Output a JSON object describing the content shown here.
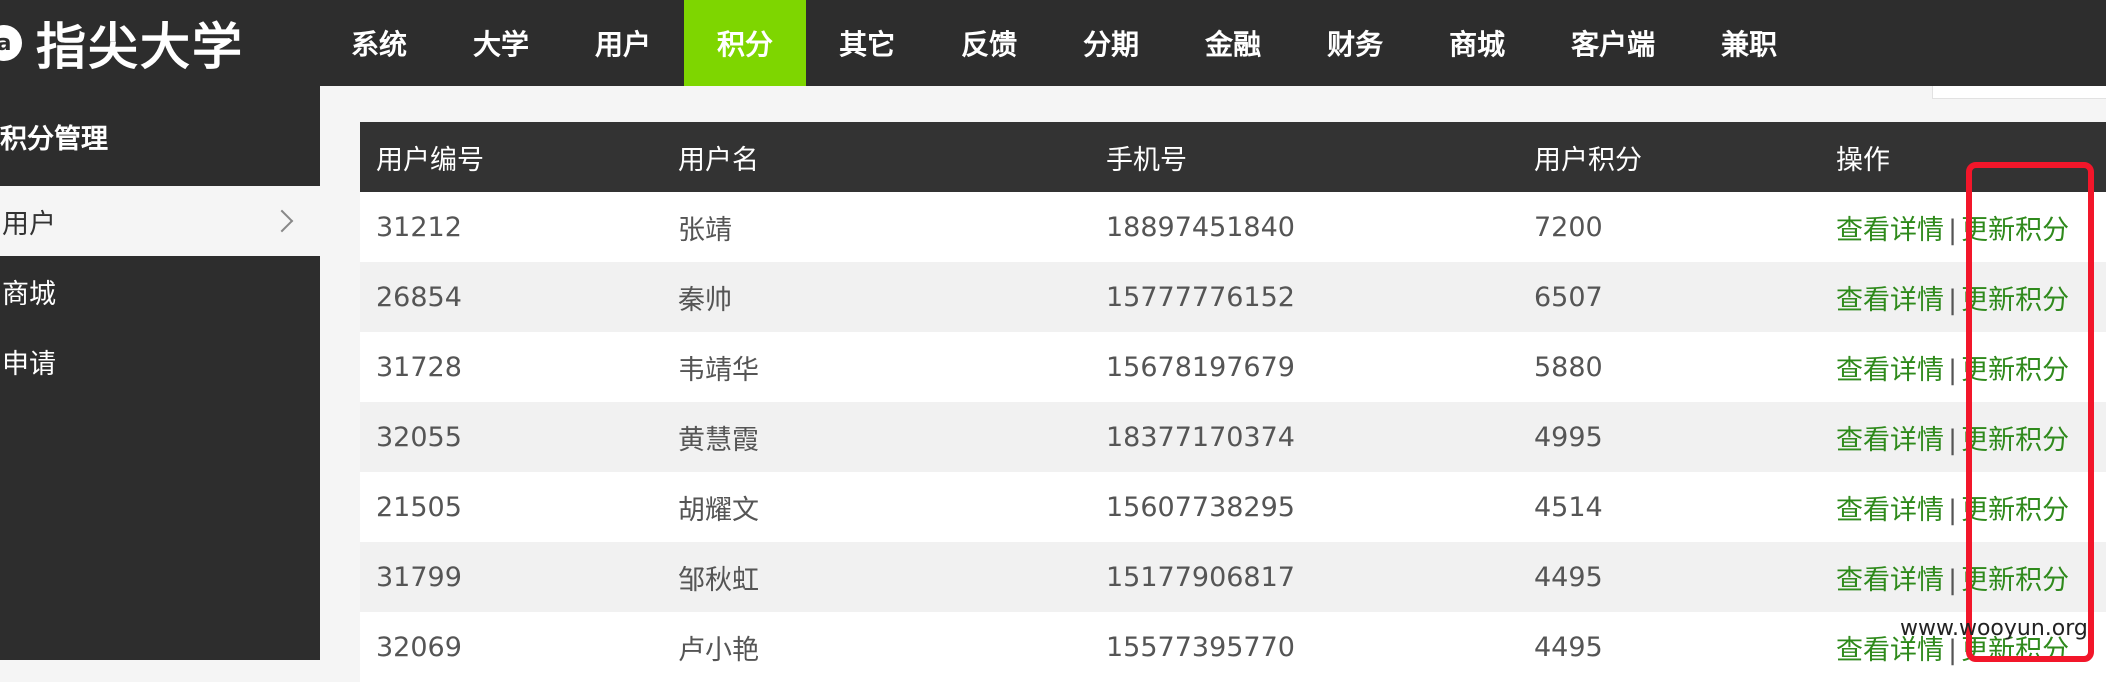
{
  "brand": {
    "mark": "a",
    "title": "指尖大学"
  },
  "nav": [
    {
      "label": "系统",
      "active": false
    },
    {
      "label": "大学",
      "active": false
    },
    {
      "label": "用户",
      "active": false
    },
    {
      "label": "积分",
      "active": true
    },
    {
      "label": "其它",
      "active": false
    },
    {
      "label": "反馈",
      "active": false
    },
    {
      "label": "分期",
      "active": false
    },
    {
      "label": "金融",
      "active": false
    },
    {
      "label": "财务",
      "active": false
    },
    {
      "label": "商城",
      "active": false
    },
    {
      "label": "客户端",
      "active": false
    },
    {
      "label": "兼职",
      "active": false
    }
  ],
  "sidebar": {
    "title": "积分管理",
    "items": [
      {
        "label": "用户",
        "active": true
      },
      {
        "label": "商城",
        "active": false
      },
      {
        "label": "申请",
        "active": false
      }
    ]
  },
  "table": {
    "headers": [
      "用户编号",
      "用户名",
      "手机号",
      "用户积分",
      "操作"
    ],
    "ops": {
      "view": "查看详情",
      "sep": "|",
      "update": "更新积分"
    },
    "rows": [
      {
        "id": "31212",
        "name": "张靖",
        "phone": "18897451840",
        "points": "7200"
      },
      {
        "id": "26854",
        "name": "秦帅",
        "phone": "15777776152",
        "points": "6507"
      },
      {
        "id": "31728",
        "name": "韦靖华",
        "phone": "15678197679",
        "points": "5880"
      },
      {
        "id": "32055",
        "name": "黄慧霞",
        "phone": "18377170374",
        "points": "4995"
      },
      {
        "id": "21505",
        "name": "胡耀文",
        "phone": "15607738295",
        "points": "4514"
      },
      {
        "id": "31799",
        "name": "邹秋虹",
        "phone": "15177906817",
        "points": "4495"
      },
      {
        "id": "32069",
        "name": "卢小艳",
        "phone": "15577395770",
        "points": "4495"
      }
    ]
  },
  "watermark": "www.wooyun.org",
  "colors": {
    "topbar": "#2d2d2d",
    "active_nav": "#7ed600",
    "link": "#2f8a1c",
    "highlight": "#f2162a"
  }
}
